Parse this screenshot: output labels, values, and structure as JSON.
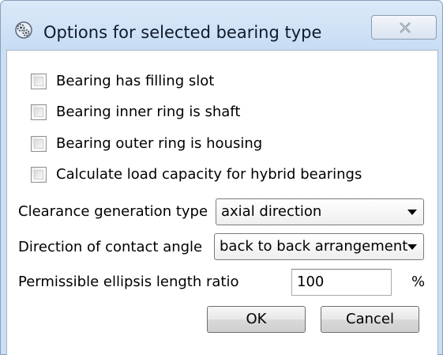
{
  "window": {
    "title": "Options for selected bearing type",
    "icon": "gears-icon",
    "close_icon": "close-icon"
  },
  "checkboxes": [
    {
      "label": "Bearing has filling slot",
      "checked": false
    },
    {
      "label": "Bearing inner ring is shaft",
      "checked": false
    },
    {
      "label": "Bearing outer ring is housing",
      "checked": false
    },
    {
      "label": "Calculate load capacity for hybrid bearings",
      "checked": false
    }
  ],
  "clearance": {
    "label": "Clearance generation type",
    "value": "axial direction"
  },
  "contact_angle": {
    "label": "Direction of contact angle",
    "value": "back to back arrangement"
  },
  "ellipsis": {
    "label": "Permissible ellipsis length ratio",
    "value": "100",
    "unit": "%"
  },
  "buttons": {
    "ok": "OK",
    "cancel": "Cancel"
  },
  "colors": {
    "titlebar": "#c9dff5",
    "border": "#8a9eb8"
  }
}
